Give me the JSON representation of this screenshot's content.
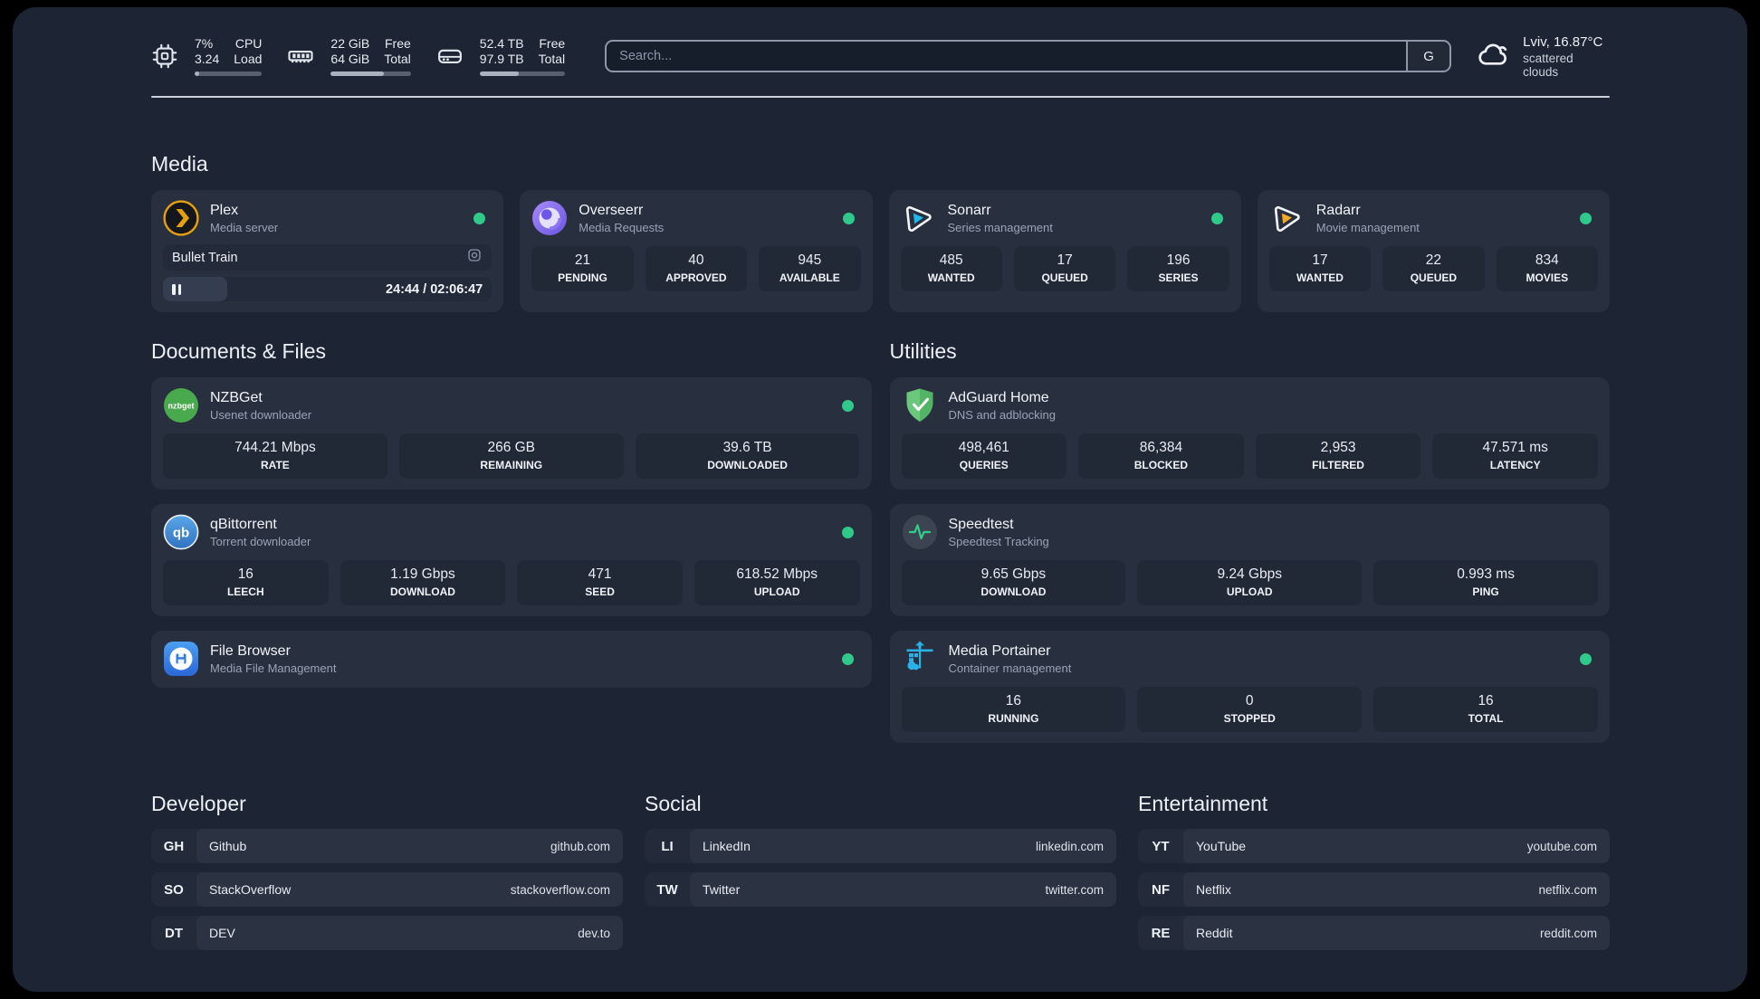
{
  "colors": {
    "panel_bg": "#1d2433",
    "card_bg": "#28303f",
    "status_online": "#2ec98b",
    "plex_amber": "#e5a00d",
    "sonarr_blue": "#1db8e8",
    "radarr_amber": "#f7a825",
    "nzbget_green": "#4aa94e",
    "qbittorrent_blue": "#3c82cc",
    "overseerr_purple": "#8b76f2",
    "adguard_green": "#5fbe70",
    "speedtest_pulse_green": "#2fd08c",
    "portainer_blue": "#29b1e8",
    "filebrowser_blue": "#3b8deb"
  },
  "topbar": {
    "cpu": {
      "icon": "cpu-chip-icon",
      "line1_value": "7%",
      "line2_value": "3.24",
      "line1_label": "CPU",
      "line2_label": "Load",
      "progress_pct": 7
    },
    "memory": {
      "icon": "memory-icon",
      "line1_value": "22 GiB",
      "line2_value": "64 GiB",
      "line1_label": "Free",
      "line2_label": "Total",
      "progress_pct": 66
    },
    "disk": {
      "icon": "disk-icon",
      "line1_value": "52.4 TB",
      "line2_value": "97.9 TB",
      "line1_label": "Free",
      "line2_label": "Total",
      "progress_pct": 46
    },
    "search": {
      "placeholder": "Search...",
      "engine_button": "G"
    },
    "weather": {
      "icon": "cloud-icon",
      "location_temp": "Lviv, 16.87°C",
      "condition": "scattered clouds"
    }
  },
  "sections": {
    "media": {
      "title": "Media",
      "plex": {
        "icon": "plex-icon",
        "name": "Plex",
        "description": "Media server",
        "status": "online",
        "now_playing": "Bullet Train",
        "time_display": "24:44 / 02:06:47",
        "progress_pct": 19.5
      },
      "overseerr": {
        "icon": "overseerr-icon",
        "name": "Overseerr",
        "description": "Media Requests",
        "status": "online",
        "stats": [
          {
            "value": "21",
            "label": "PENDING"
          },
          {
            "value": "40",
            "label": "APPROVED"
          },
          {
            "value": "945",
            "label": "AVAILABLE"
          }
        ]
      },
      "sonarr": {
        "icon": "sonarr-icon",
        "name": "Sonarr",
        "description": "Series management",
        "status": "online",
        "stats": [
          {
            "value": "485",
            "label": "WANTED"
          },
          {
            "value": "17",
            "label": "QUEUED"
          },
          {
            "value": "196",
            "label": "SERIES"
          }
        ]
      },
      "radarr": {
        "icon": "radarr-icon",
        "name": "Radarr",
        "description": "Movie management",
        "status": "online",
        "stats": [
          {
            "value": "17",
            "label": "WANTED"
          },
          {
            "value": "22",
            "label": "QUEUED"
          },
          {
            "value": "834",
            "label": "MOVIES"
          }
        ]
      }
    },
    "documents": {
      "title": "Documents & Files",
      "nzbget": {
        "icon": "nzbget-icon",
        "name": "NZBGet",
        "description": "Usenet downloader",
        "status": "online",
        "stats": [
          {
            "value": "744.21 Mbps",
            "label": "RATE"
          },
          {
            "value": "266 GB",
            "label": "REMAINING"
          },
          {
            "value": "39.6 TB",
            "label": "DOWNLOADED"
          }
        ]
      },
      "qbittorrent": {
        "icon": "qbittorrent-icon",
        "name": "qBittorrent",
        "description": "Torrent downloader",
        "status": "online",
        "stats": [
          {
            "value": "16",
            "label": "LEECH"
          },
          {
            "value": "1.19 Gbps",
            "label": "DOWNLOAD"
          },
          {
            "value": "471",
            "label": "SEED"
          },
          {
            "value": "618.52 Mbps",
            "label": "UPLOAD"
          }
        ]
      },
      "filebrowser": {
        "icon": "filebrowser-icon",
        "name": "File Browser",
        "description": "Media File Management",
        "status": "online"
      }
    },
    "utilities": {
      "title": "Utilities",
      "adguard": {
        "icon": "adguard-icon",
        "name": "AdGuard Home",
        "description": "DNS and adblocking",
        "stats": [
          {
            "value": "498,461",
            "label": "QUERIES"
          },
          {
            "value": "86,384",
            "label": "BLOCKED"
          },
          {
            "value": "2,953",
            "label": "FILTERED"
          },
          {
            "value": "47.571 ms",
            "label": "LATENCY"
          }
        ]
      },
      "speedtest": {
        "icon": "speedtest-icon",
        "name": "Speedtest",
        "description": "Speedtest Tracking",
        "stats": [
          {
            "value": "9.65 Gbps",
            "label": "DOWNLOAD"
          },
          {
            "value": "9.24 Gbps",
            "label": "UPLOAD"
          },
          {
            "value": "0.993 ms",
            "label": "PING"
          }
        ]
      },
      "portainer": {
        "icon": "portainer-icon",
        "name": "Media Portainer",
        "description": "Container management",
        "status": "online",
        "stats": [
          {
            "value": "16",
            "label": "RUNNING"
          },
          {
            "value": "0",
            "label": "STOPPED"
          },
          {
            "value": "16",
            "label": "TOTAL"
          }
        ]
      }
    },
    "developer": {
      "title": "Developer",
      "bookmarks": [
        {
          "abbr": "GH",
          "name": "Github",
          "domain": "github.com"
        },
        {
          "abbr": "SO",
          "name": "StackOverflow",
          "domain": "stackoverflow.com"
        },
        {
          "abbr": "DT",
          "name": "DEV",
          "domain": "dev.to"
        }
      ]
    },
    "social": {
      "title": "Social",
      "bookmarks": [
        {
          "abbr": "LI",
          "name": "LinkedIn",
          "domain": "linkedin.com"
        },
        {
          "abbr": "TW",
          "name": "Twitter",
          "domain": "twitter.com"
        }
      ]
    },
    "entertainment": {
      "title": "Entertainment",
      "bookmarks": [
        {
          "abbr": "YT",
          "name": "YouTube",
          "domain": "youtube.com"
        },
        {
          "abbr": "NF",
          "name": "Netflix",
          "domain": "netflix.com"
        },
        {
          "abbr": "RE",
          "name": "Reddit",
          "domain": "reddit.com"
        }
      ]
    }
  }
}
